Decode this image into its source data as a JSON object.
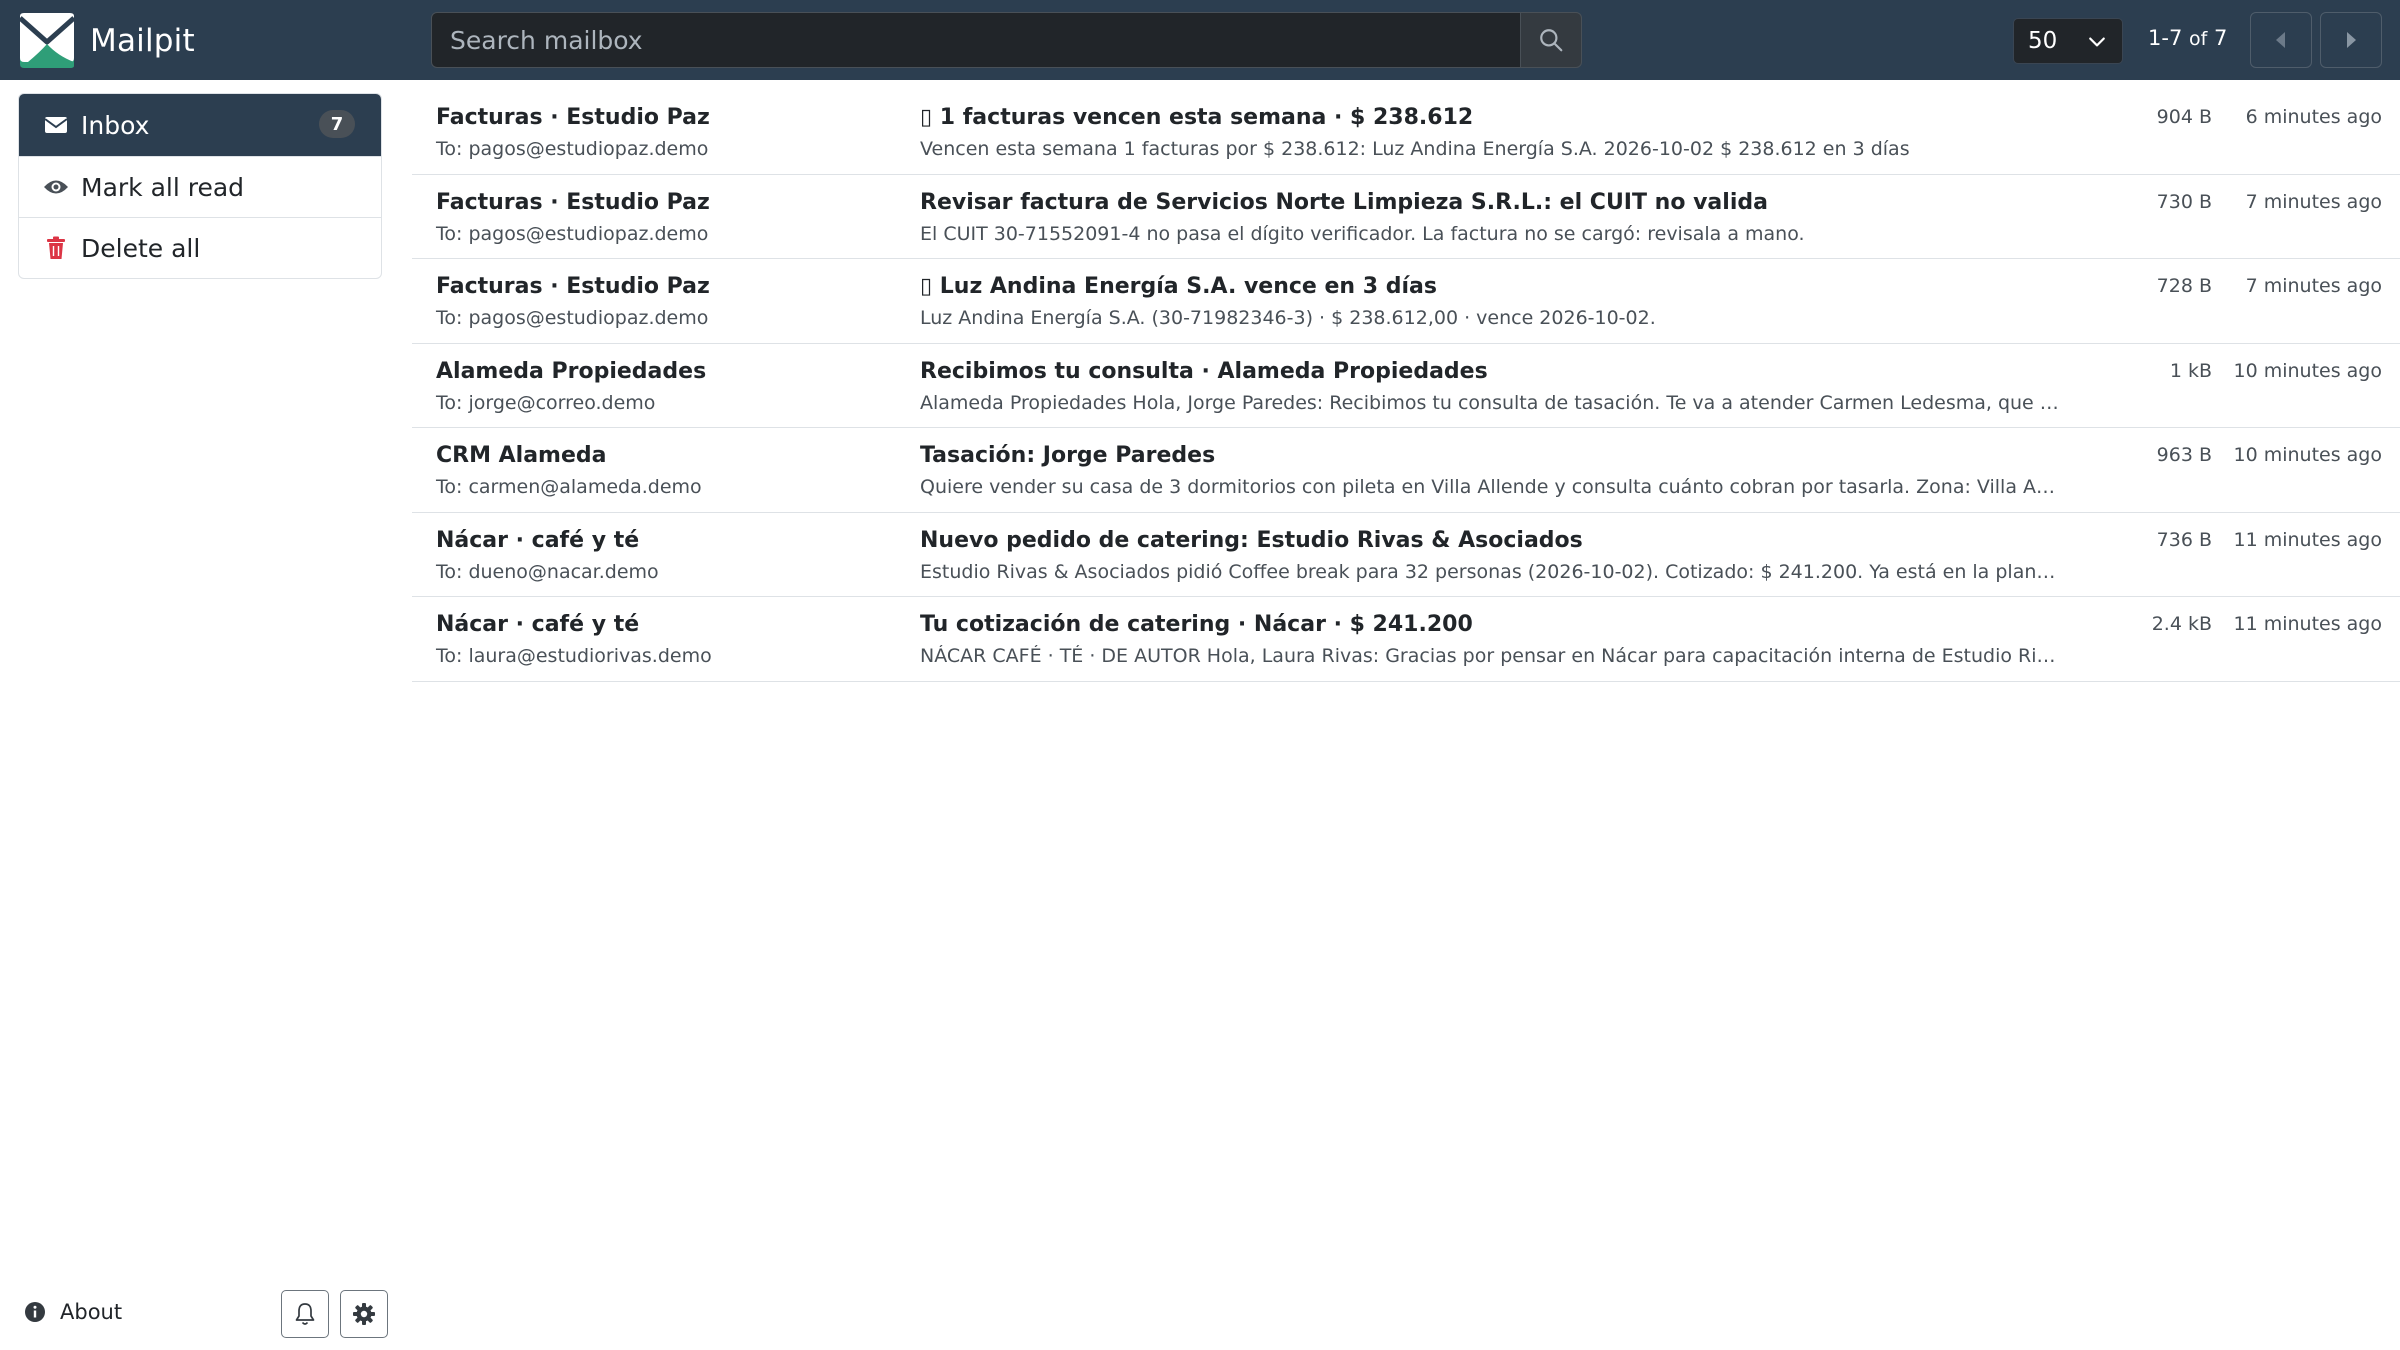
{
  "header": {
    "brand": "Mailpit",
    "search_placeholder": "Search mailbox",
    "per_page": "50",
    "paging_range": "1-7",
    "paging_of": "of",
    "paging_total": "7",
    "background_color": "#2c3e50"
  },
  "sidebar": {
    "items": [
      {
        "label": "Inbox",
        "icon": "envelope-icon",
        "badge": "7",
        "active": true
      },
      {
        "label": "Mark all read",
        "icon": "eye-icon"
      },
      {
        "label": "Delete all",
        "icon": "trash-icon",
        "icon_color": "#dc3545"
      }
    ],
    "about_label": "About"
  },
  "messages": [
    {
      "from": "Facturas · Estudio Paz",
      "to": "To: pagos@estudiopaz.demo",
      "subject": "▯ 1 facturas vencen esta semana · $ 238.612",
      "snippet": "Vencen esta semana 1 facturas por $ 238.612: Luz Andina Energía S.A. 2026-10-02 $ 238.612 en 3 días",
      "size": "904 B",
      "time": "6 minutes ago"
    },
    {
      "from": "Facturas · Estudio Paz",
      "to": "To: pagos@estudiopaz.demo",
      "subject": "Revisar factura de Servicios Norte Limpieza S.R.L.: el CUIT no valida",
      "snippet": "El CUIT 30-71552091-4 no pasa el dígito verificador. La factura no se cargó: revisala a mano.",
      "size": "730 B",
      "time": "7 minutes ago"
    },
    {
      "from": "Facturas · Estudio Paz",
      "to": "To: pagos@estudiopaz.demo",
      "subject": "▯ Luz Andina Energía S.A. vence en 3 días",
      "snippet": "Luz Andina Energía S.A. (30-71982346-3) · $ 238.612,00 · vence 2026-10-02.",
      "size": "728 B",
      "time": "7 minutes ago"
    },
    {
      "from": "Alameda Propiedades",
      "to": "To: jorge@correo.demo",
      "subject": "Recibimos tu consulta · Alameda Propiedades",
      "snippet": "Alameda Propiedades Hola, Jorge Paredes: Recibimos tu consulta de tasación. Te va a atender Carmen Ledesma, que te...",
      "size": "1 kB",
      "time": "10 minutes ago"
    },
    {
      "from": "CRM Alameda",
      "to": "To: carmen@alameda.demo",
      "subject": "Tasación: Jorge Paredes",
      "snippet": "Quiere vender su casa de 3 dormitorios con pileta en Villa Allende y consulta cuánto cobran por tasarla. Zona: Villa Alle...",
      "size": "963 B",
      "time": "10 minutes ago"
    },
    {
      "from": "Nácar · café y té",
      "to": "To: dueno@nacar.demo",
      "subject": "Nuevo pedido de catering: Estudio Rivas & Asociados",
      "snippet": "Estudio Rivas & Asociados pidió Coffee break para 32 personas (2026-10-02). Cotizado: $ 241.200. Ya está en la planilla...",
      "size": "736 B",
      "time": "11 minutes ago"
    },
    {
      "from": "Nácar · café y té",
      "to": "To: laura@estudiorivas.demo",
      "subject": "Tu cotización de catering · Nácar · $ 241.200",
      "snippet": "NÁCAR CAFÉ · TÉ · DE AUTOR Hola, Laura Rivas: Gracias por pensar en Nácar para capacitación interna de Estudio Riva...",
      "size": "2.4 kB",
      "time": "11 minutes ago"
    }
  ]
}
